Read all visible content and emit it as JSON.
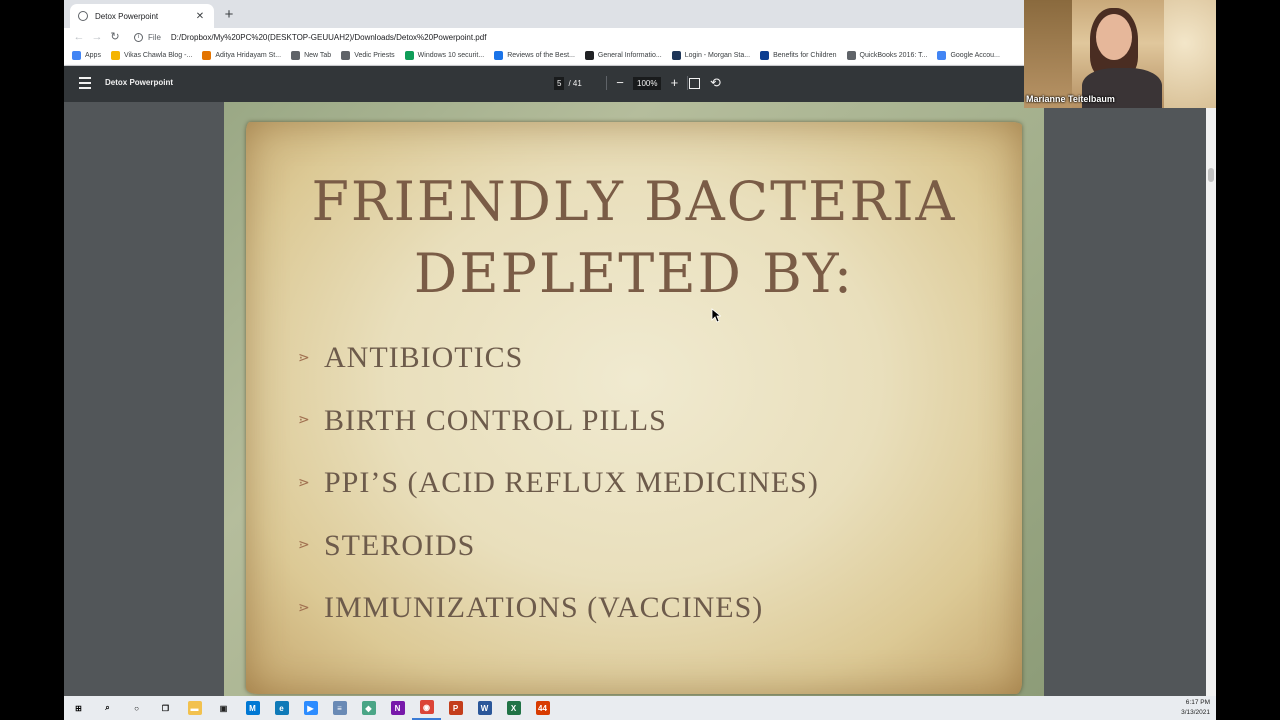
{
  "browser": {
    "tab_title": "Detox Powerpoint",
    "tab_close": "✕",
    "new_tab": "+",
    "nav": {
      "back": "←",
      "forward": "→",
      "reload": "↻"
    },
    "address": {
      "scheme": "File",
      "url": "D:/Dropbox/My%20PC%20(DESKTOP-GEUUAH2)/Downloads/Detox%20Powerpoint.pdf"
    },
    "bookmarks": [
      {
        "label": "Apps",
        "icon": "apps-grid-icon",
        "color": "#4285f4"
      },
      {
        "label": "Vikas Chawla Blog -...",
        "icon": "blog-icon",
        "color": "#f4b400"
      },
      {
        "label": "Aditya Hridayam St...",
        "icon": "a-logo-icon",
        "color": "#e37400"
      },
      {
        "label": "New Tab",
        "icon": "globe-icon",
        "color": "#5f6368"
      },
      {
        "label": "Vedic Priests",
        "icon": "globe-icon",
        "color": "#5f6368"
      },
      {
        "label": "Windows 10 securit...",
        "icon": "wifi-icon",
        "color": "#0f9d58"
      },
      {
        "label": "Reviews of the Best...",
        "icon": "w-logo-icon",
        "color": "#1a73e8"
      },
      {
        "label": "General Informatio...",
        "icon": "info-icon",
        "color": "#202124"
      },
      {
        "label": "Login - Morgan Sta...",
        "icon": "ms-logo-icon",
        "color": "#1d3557"
      },
      {
        "label": "Benefits for Children",
        "icon": "ssa-logo-icon",
        "color": "#0b3d91"
      },
      {
        "label": "QuickBooks 2016: T...",
        "icon": "globe-icon",
        "color": "#5f6368"
      },
      {
        "label": "Google Accou...",
        "icon": "google-icon",
        "color": "#4285f4"
      }
    ]
  },
  "pdf_toolbar": {
    "title": "Detox Powerpoint",
    "current_page": "5",
    "total_pages": "/ 41",
    "zoom": "100%",
    "zoom_out": "−",
    "zoom_in": "+",
    "rotate": "⟲"
  },
  "slide": {
    "title_line1": "FRIENDLY BACTERIA",
    "title_line2": "DEPLETED BY:",
    "bullet_glyph": "⋗",
    "bullets": [
      "ANTIBIOTICS",
      "BIRTH CONTROL PILLS",
      "PPI’S (ACID REFLUX MEDICINES)",
      "STEROIDS",
      "IMMUNIZATIONS (VACCINES)"
    ]
  },
  "webcam": {
    "participant_name": "Marianne Teitelbaum"
  },
  "taskbar": {
    "items": [
      {
        "icon": "windows-start-icon",
        "glyph": "⊞",
        "color": "#000000"
      },
      {
        "icon": "search-icon",
        "glyph": "⌕",
        "color": "#000000"
      },
      {
        "icon": "cortana-icon",
        "glyph": "○",
        "color": "#000000"
      },
      {
        "icon": "task-view-icon",
        "glyph": "❐",
        "color": "#000000"
      },
      {
        "icon": "file-explorer-icon",
        "glyph": "▬",
        "color": "#f2c14e"
      },
      {
        "icon": "store-icon",
        "glyph": "▣",
        "color": "#222222"
      },
      {
        "icon": "mail-m-icon",
        "glyph": "M",
        "color": "#0078d4"
      },
      {
        "icon": "edge-icon",
        "glyph": "e",
        "color": "#0f7ab8"
      },
      {
        "icon": "zoom-icon",
        "glyph": "▶",
        "color": "#2d8cff"
      },
      {
        "icon": "notepad-icon",
        "glyph": "≡",
        "color": "#6a8ab5"
      },
      {
        "icon": "app-green-icon",
        "glyph": "◆",
        "color": "#4aa586"
      },
      {
        "icon": "onenote-icon",
        "glyph": "N",
        "color": "#7719aa"
      },
      {
        "icon": "chrome-icon",
        "glyph": "◉",
        "color": "#db4437"
      },
      {
        "icon": "powerpoint-icon",
        "glyph": "P",
        "color": "#c43e1c"
      },
      {
        "icon": "word-icon",
        "glyph": "W",
        "color": "#2b579a"
      },
      {
        "icon": "excel-icon",
        "glyph": "X",
        "color": "#217346"
      },
      {
        "icon": "app-badge-icon",
        "glyph": "44",
        "color": "#d83b01"
      }
    ],
    "time": "6:17 PM",
    "date": "3/13/2021"
  }
}
